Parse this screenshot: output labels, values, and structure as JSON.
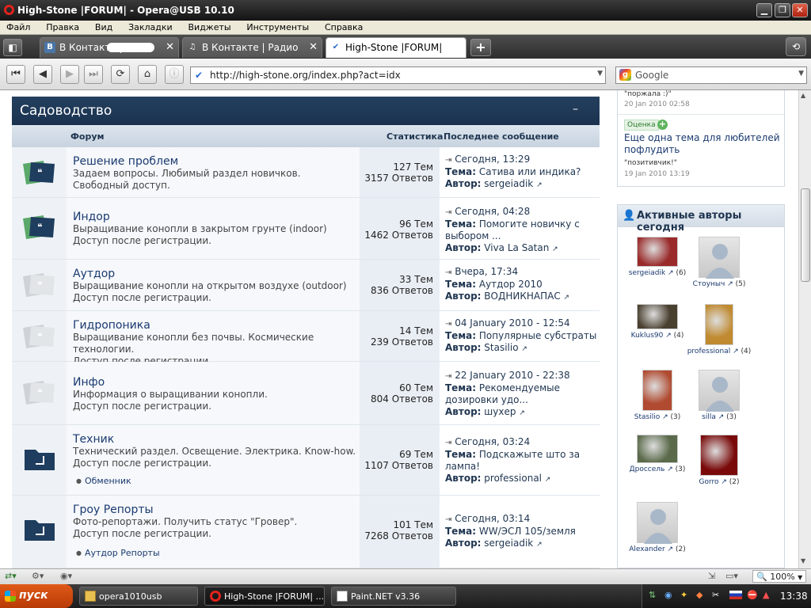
{
  "window": {
    "title": "High-Stone |FORUM| - Opera@USB 10.10"
  },
  "menu": [
    "Файл",
    "Правка",
    "Вид",
    "Закладки",
    "Виджеты",
    "Инструменты",
    "Справка"
  ],
  "tabs": [
    {
      "label": "В Контакте |",
      "icon": "vk-icon"
    },
    {
      "label": "В Контакте | Радио",
      "icon": "music-note-icon"
    },
    {
      "label": "High-Stone |FORUM|",
      "icon": "highstone-icon"
    }
  ],
  "address": {
    "url": "http://high-stone.org/index.php?act=idx",
    "search_engine": "Google"
  },
  "category": {
    "title": "Садоводство",
    "collapse": "–",
    "col_forum": "Форум",
    "col_stats": "Статистика",
    "col_last": "Последнее сообщение"
  },
  "forums": [
    {
      "name": "Решение проблем",
      "desc1": "Задаем вопросы. Любимый раздел новичков.",
      "desc2": "Свободный доступ.",
      "topics": "127 Тем",
      "replies": "3157 Ответов",
      "last_date": "Сегодня, 13:29",
      "last_topic": "Сатива или индика?",
      "last_author": "sergeiadik",
      "icon": "new-posts"
    },
    {
      "name": "Индор",
      "desc1": "Выращивание конопли в закрытом грунте (indoor)",
      "desc2": "Доступ после регистрации.",
      "topics": "96 Тем",
      "replies": "1462 Ответов",
      "last_date": "Сегодня, 04:28",
      "last_topic": "Помогите новичку с выбором ...",
      "last_author": "Viva La Satan",
      "icon": "new-posts"
    },
    {
      "name": "Аутдор",
      "desc1": "Выращивание конопли на открытом воздухе (outdoor)",
      "desc2": "Доступ после регистрации.",
      "topics": "33 Тем",
      "replies": "836 Ответов",
      "last_date": "Вчера, 17:34",
      "last_topic": "Аутдор 2010",
      "last_author": "ВОДНИКНАПАС",
      "icon": "no-new"
    },
    {
      "name": "Гидропоника",
      "desc1": "Выращивание конопли без почвы. Космические технологии.",
      "desc2": "Доступ после регистрации.",
      "topics": "14 Тем",
      "replies": "239 Ответов",
      "last_date": "04 January 2010 - 12:54",
      "last_topic": "Популярные субстраты",
      "last_author": "Stasilio",
      "icon": "no-new"
    },
    {
      "name": "Инфо",
      "desc1": "Информация о выращивании конопли.",
      "desc2": "Доступ после регистрации.",
      "topics": "60 Тем",
      "replies": "804 Ответов",
      "last_date": "22 January 2010 - 22:38",
      "last_topic": "Рекомендуемые дозировки удо...",
      "last_author": "шухер",
      "icon": "no-new"
    },
    {
      "name": "Техник",
      "desc1": "Технический раздел. Освещение. Электрика. Know-how.",
      "desc2": "Доступ после регистрации.",
      "sub": "Обменник",
      "topics": "69 Тем",
      "replies": "1107 Ответов",
      "last_date": "Сегодня, 03:24",
      "last_topic": "Подскажыте што за лампа!",
      "last_author": "professional",
      "icon": "folder"
    },
    {
      "name": "Гроу Репорты",
      "desc1": "Фото-репортажи. Получить статус \"Гровер\".",
      "desc2": "Доступ после регистрации.",
      "sub": "Аутдор Репорты",
      "topics": "101 Тем",
      "replies": "7268 Ответов",
      "last_date": "Сегодня, 03:14",
      "last_topic": "WW/ЭСЛ 105/земля",
      "last_author": "sergeiadik",
      "icon": "folder"
    }
  ],
  "labels": {
    "topic": "Тема:",
    "author": "Автор:"
  },
  "sidebar_top": {
    "quote1": "\"поржала :)\"",
    "date1": "20 Jan 2010 02:58",
    "badge": "Оценка",
    "item_title": "Еще одна тема для любителей пофлудить",
    "quote2": "\"позитивчик!\"",
    "date2": "19 Jan 2010 13:19"
  },
  "active_authors": {
    "title": "Активные авторы сегодня",
    "users": [
      {
        "name": "sergeiadik",
        "count": "(6)",
        "color": "#9a2a2a"
      },
      {
        "name": "Стоуныч",
        "count": "(5)",
        "color": ""
      },
      {
        "name": "Kuklus90",
        "count": "(4)",
        "color": "#4a4030"
      },
      {
        "name": "professional",
        "count": "(4)",
        "color": "#c08a30"
      },
      {
        "name": "Stasilio",
        "count": "(3)",
        "color": "#b04a30"
      },
      {
        "name": "silla",
        "count": "(3)",
        "color": ""
      },
      {
        "name": "Дроссель",
        "count": "(3)",
        "color": "#5a6a4a"
      },
      {
        "name": "Gorro",
        "count": "(2)",
        "color": "#7a0a0a"
      },
      {
        "name": "Alexander",
        "count": "(2)",
        "color": ""
      }
    ]
  },
  "statusbar": {
    "zoom": "100%"
  },
  "taskbar": {
    "start": "пуск",
    "tasks": [
      "opera1010usb",
      "High-Stone |FORUM| ...",
      "Paint.NET v3.36"
    ],
    "clock": "13:38"
  }
}
